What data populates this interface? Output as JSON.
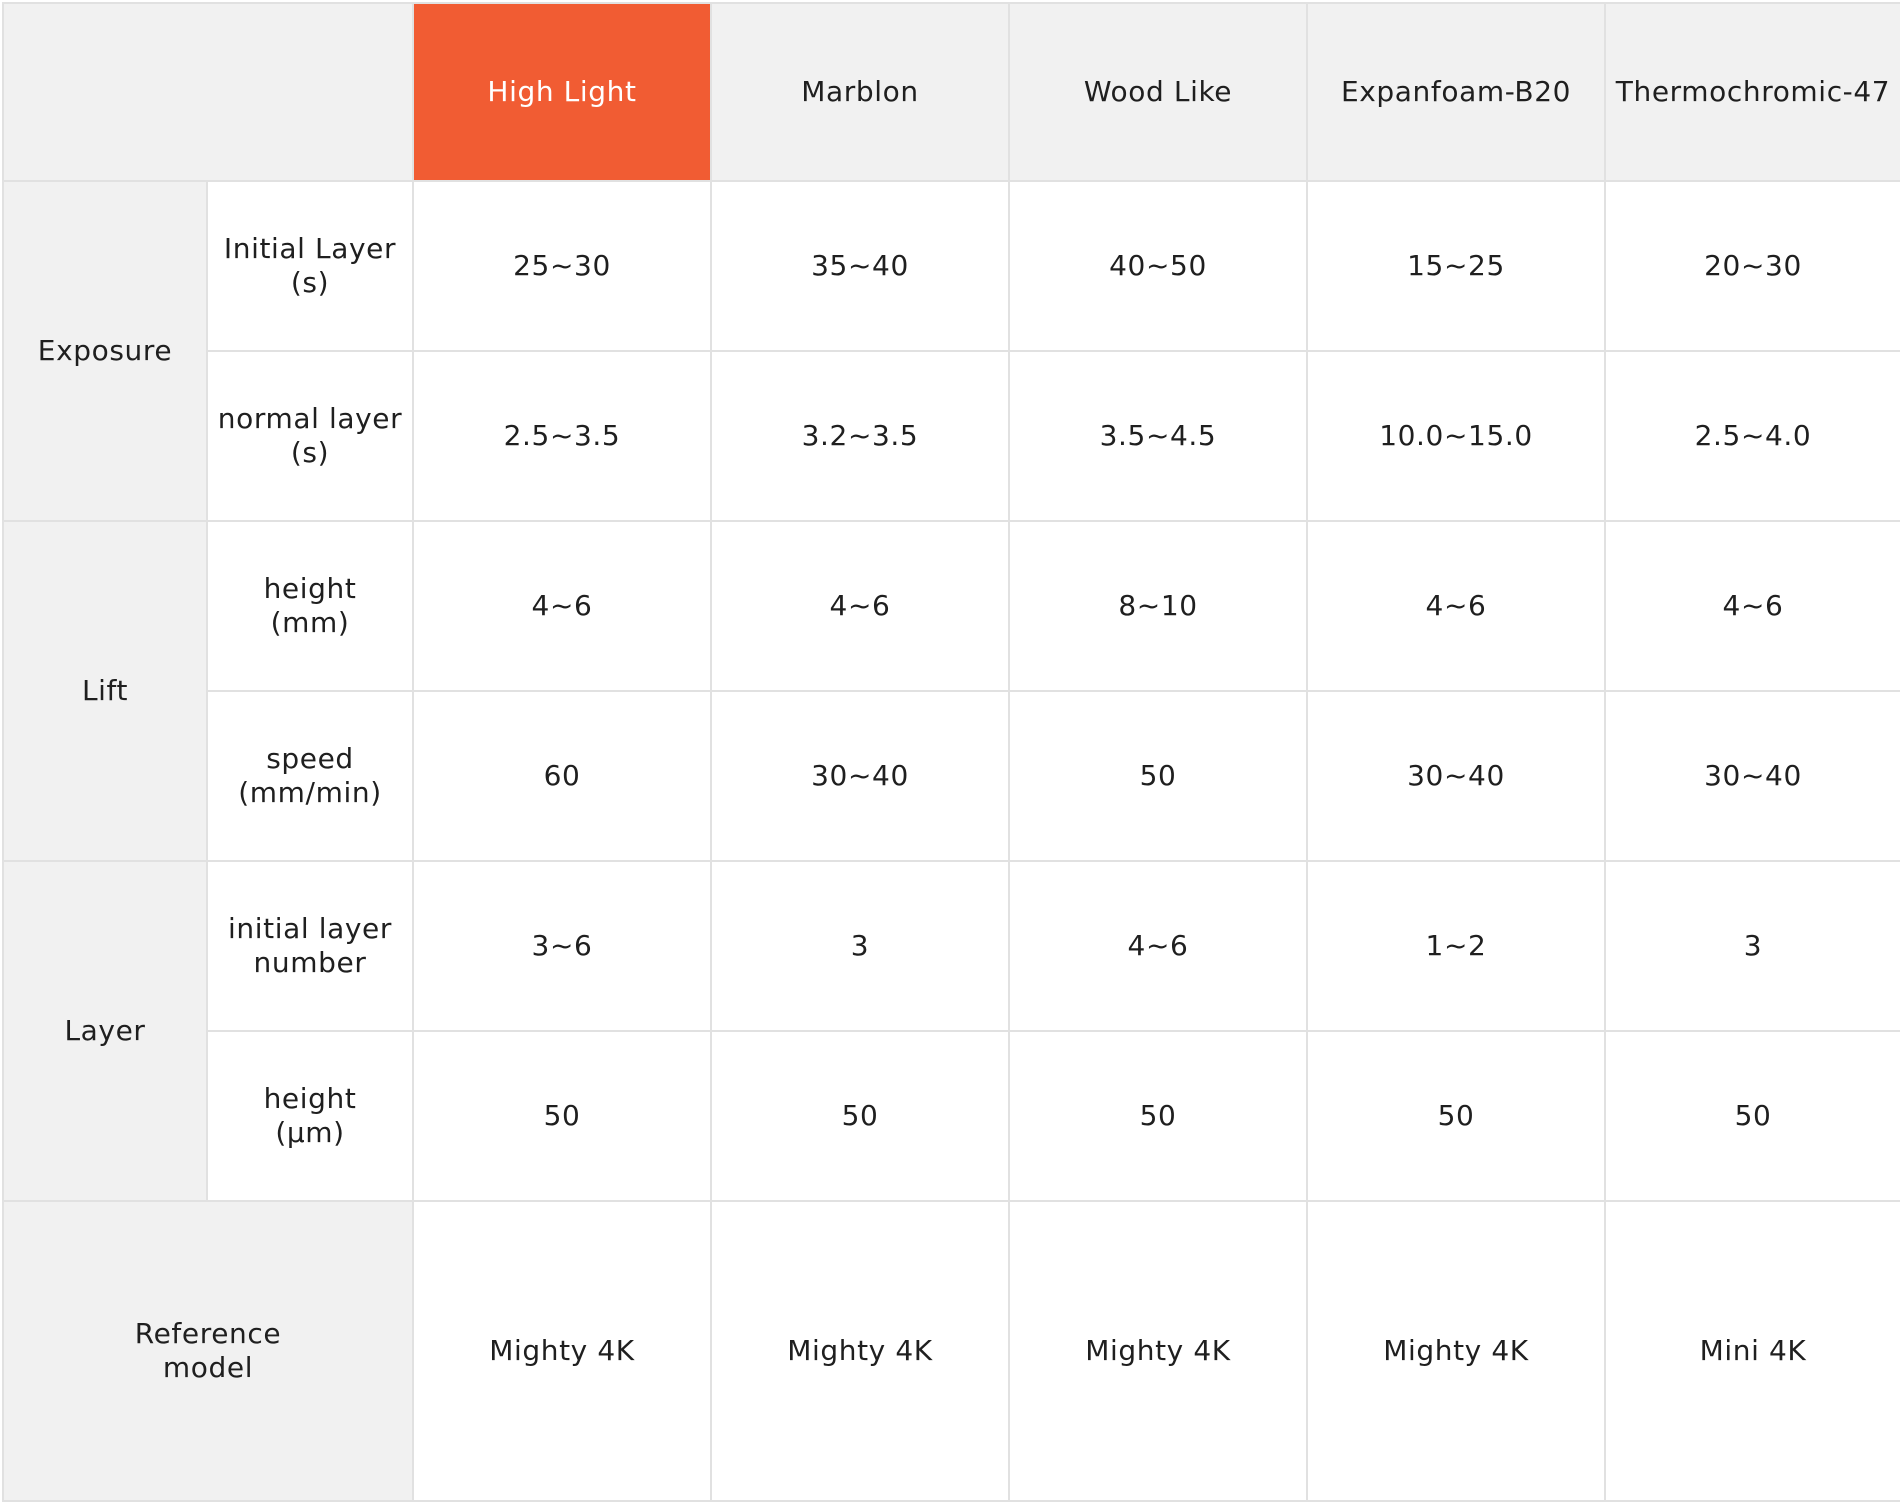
{
  "colors": {
    "accent": "#f15c33",
    "label_background": "#f1f1f1",
    "grid_line": "#e1e1e1"
  },
  "materials": [
    {
      "name": "High Light",
      "highlighted": true
    },
    {
      "name": "Marblon",
      "highlighted": false
    },
    {
      "name": "Wood Like",
      "highlighted": false
    },
    {
      "name": "Expanfoam-B20",
      "highlighted": false
    },
    {
      "name": "Thermochromic-47",
      "highlighted": false
    }
  ],
  "groups": {
    "exposure": {
      "label": "Exposure",
      "rows": [
        {
          "label_line1": "Initial Layer",
          "label_line2": "(s)",
          "values": [
            "25~30",
            "35~40",
            "40~50",
            "15~25",
            "20~30"
          ]
        },
        {
          "label_line1": "normal layer",
          "label_line2": "(s)",
          "values": [
            "2.5~3.5",
            "3.2~3.5",
            "3.5~4.5",
            "10.0~15.0",
            "2.5~4.0"
          ]
        }
      ]
    },
    "lift": {
      "label": "Lift",
      "rows": [
        {
          "label_line1": "height",
          "label_line2": "(mm)",
          "values": [
            "4~6",
            "4~6",
            "8~10",
            "4~6",
            "4~6"
          ]
        },
        {
          "label_line1": "speed",
          "label_line2": "(mm/min)",
          "values": [
            "60",
            "30~40",
            "50",
            "30~40",
            "30~40"
          ]
        }
      ]
    },
    "layer": {
      "label": "Layer",
      "rows": [
        {
          "label_line1": "initial layer",
          "label_line2": "number",
          "values": [
            "3~6",
            "3",
            "4~6",
            "1~2",
            "3"
          ]
        },
        {
          "label_line1": "height",
          "label_line2": "(μm)",
          "values": [
            "50",
            "50",
            "50",
            "50",
            "50"
          ]
        }
      ]
    }
  },
  "reference": {
    "label_line1": "Reference",
    "label_line2": "model",
    "values": [
      "Mighty 4K",
      "Mighty 4K",
      "Mighty 4K",
      "Mighty 4K",
      "Mini 4K"
    ]
  }
}
